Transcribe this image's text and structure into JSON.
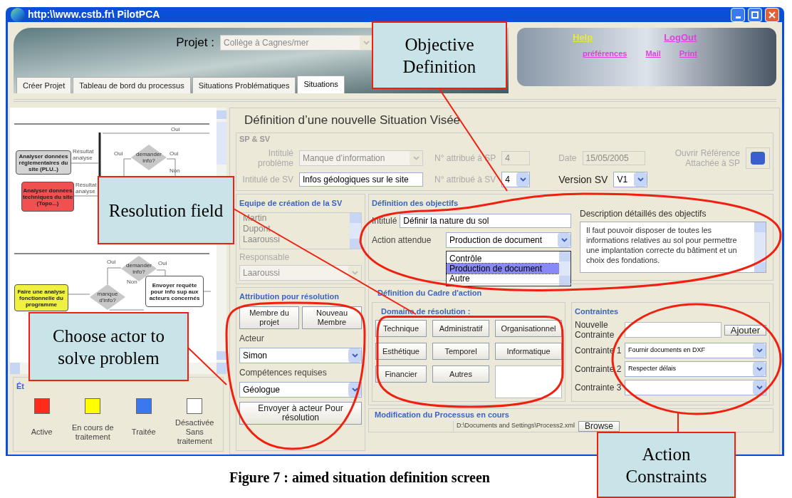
{
  "window": {
    "title": "http:\\\\www.cstb.fr\\ PilotPCA"
  },
  "header": {
    "project_label": "Projet :",
    "project": {
      "value": "Collège à Cagnes/mer",
      "disabled": true
    },
    "links": [
      {
        "label": "Help",
        "color": "#e8e83a"
      },
      {
        "label": "LogOut",
        "color": "#e040e0"
      },
      {
        "label": "préférences",
        "color": "#e040e0"
      },
      {
        "label": "Mail",
        "color": "#e040e0"
      },
      {
        "label": "Print",
        "color": "#e040e0"
      }
    ],
    "tabs": [
      {
        "label": "Créer Projet",
        "selected": false
      },
      {
        "label": "Tableau de bord du processus",
        "selected": false
      },
      {
        "label": "Situations Problématiques",
        "selected": false
      },
      {
        "label": "Situations",
        "selected": true
      }
    ]
  },
  "diagram": {
    "nodes": [
      {
        "text": "Analyser données réglementaires du site (PLU..)",
        "color": "#d4d4d4"
      },
      {
        "text": "Analyser données techniques du site (Topo...)",
        "color": "#f05050"
      },
      {
        "text": "Faire une analyse fonctionnelle du programme",
        "color": "#f0f040"
      },
      {
        "text": "Envoyer requête pour info sup aux acteurs concernés",
        "color": "#ffffff"
      }
    ],
    "decisions": [
      "demander info?",
      "demander info?",
      "manque d'info?"
    ],
    "labels": [
      "Résultat analyse",
      "Résultat analyse",
      "Oui",
      "Oui",
      "Oui",
      "Non",
      "Oui",
      "Oui",
      "Non"
    ]
  },
  "legend": {
    "title": "Ét",
    "items": [
      {
        "label": "Active",
        "color": "#ff2a1a"
      },
      {
        "label": "En cours de traitement",
        "color": "#ffff00"
      },
      {
        "label": "Traitée",
        "color": "#3a78f0"
      },
      {
        "label": "Désactivée Sans traitement",
        "color": "#ffffff"
      }
    ]
  },
  "form": {
    "title": "Définition d’une nouvelle Situation Visée",
    "sp_sv": {
      "legend": "SP & SV",
      "problem_label": "Intitulé problème",
      "problem": {
        "value": "Manque d’information",
        "disabled": true
      },
      "sp_number_label": "N° attribué à SP",
      "sp_number": {
        "value": "4",
        "disabled": true
      },
      "date_label": "Date",
      "date": {
        "value": "15/05/2005",
        "disabled": true
      },
      "reference_label": "Ouvrir Référence Attachée à SP",
      "sv_label": "Intitulé de SV",
      "sv": "Infos géologiques sur le site",
      "sv_number_label": "N° attribué à SV",
      "sv_number": "4",
      "version_label": "Version SV",
      "version": "V1"
    },
    "team": {
      "title": "Equipe de création de la SV",
      "members": [
        "Martin",
        "Dupont",
        "Laaroussi"
      ],
      "disabled": true,
      "responsible_label": "Responsable",
      "responsible": "Laaroussi"
    },
    "attribution": {
      "title": "Attribution pour résolution",
      "buttons": [
        "Membre du projet",
        "Nouveau Membre"
      ],
      "actor_label": "Acteur",
      "actor": "Simon",
      "skills_label": "Compétences requises",
      "skills": "Géologue",
      "send_button": "Envoyer à acteur Pour résolution"
    },
    "objectives": {
      "title": "Définition des objectifs",
      "title_label": "Intitulé",
      "title_value": "Définir la nature du sol",
      "action_label": "Action attendue",
      "action": "Production de document",
      "options": [
        {
          "label": "Contrôle",
          "selected": false
        },
        {
          "label": "Production de document",
          "selected": true
        },
        {
          "label": "Autre",
          "selected": false
        }
      ],
      "description_label": "Description détaillés des objectifs",
      "description": "Il faut pouvoir disposer de toutes les informations relatives au sol pour permettre une implantation correcte du bâtiment et un choix des fondations."
    },
    "action_frame": {
      "title": "Définition du Cadre d'action",
      "domain_title": "Domaine de résolution :",
      "domains": [
        "Technique",
        "Administratif",
        "Organisationnel",
        "Esthétique",
        "Temporel",
        "Informatique",
        "Financier",
        "Autres"
      ],
      "constraints_title": "Contraintes",
      "new_constraint_label": "Nouvelle Contrainte",
      "add_button": "Ajouter",
      "constraints": [
        {
          "label": "Contrainte 1",
          "value": "Fournir documents en DXF"
        },
        {
          "label": "Contrainte 2",
          "value": "Respecter délais"
        },
        {
          "label": "Contrainte 3"
        }
      ]
    },
    "process": {
      "title": "Modification du Processus en cours",
      "path": "D:\\Documents and Settings\\Process2.xml",
      "browse_button": "Browse"
    }
  },
  "callouts": [
    "Objective Definition",
    "Resolution field",
    "Choose actor to solve problem",
    "Action Constraints"
  ],
  "caption": "Figure 7 : aimed situation definition screen"
}
